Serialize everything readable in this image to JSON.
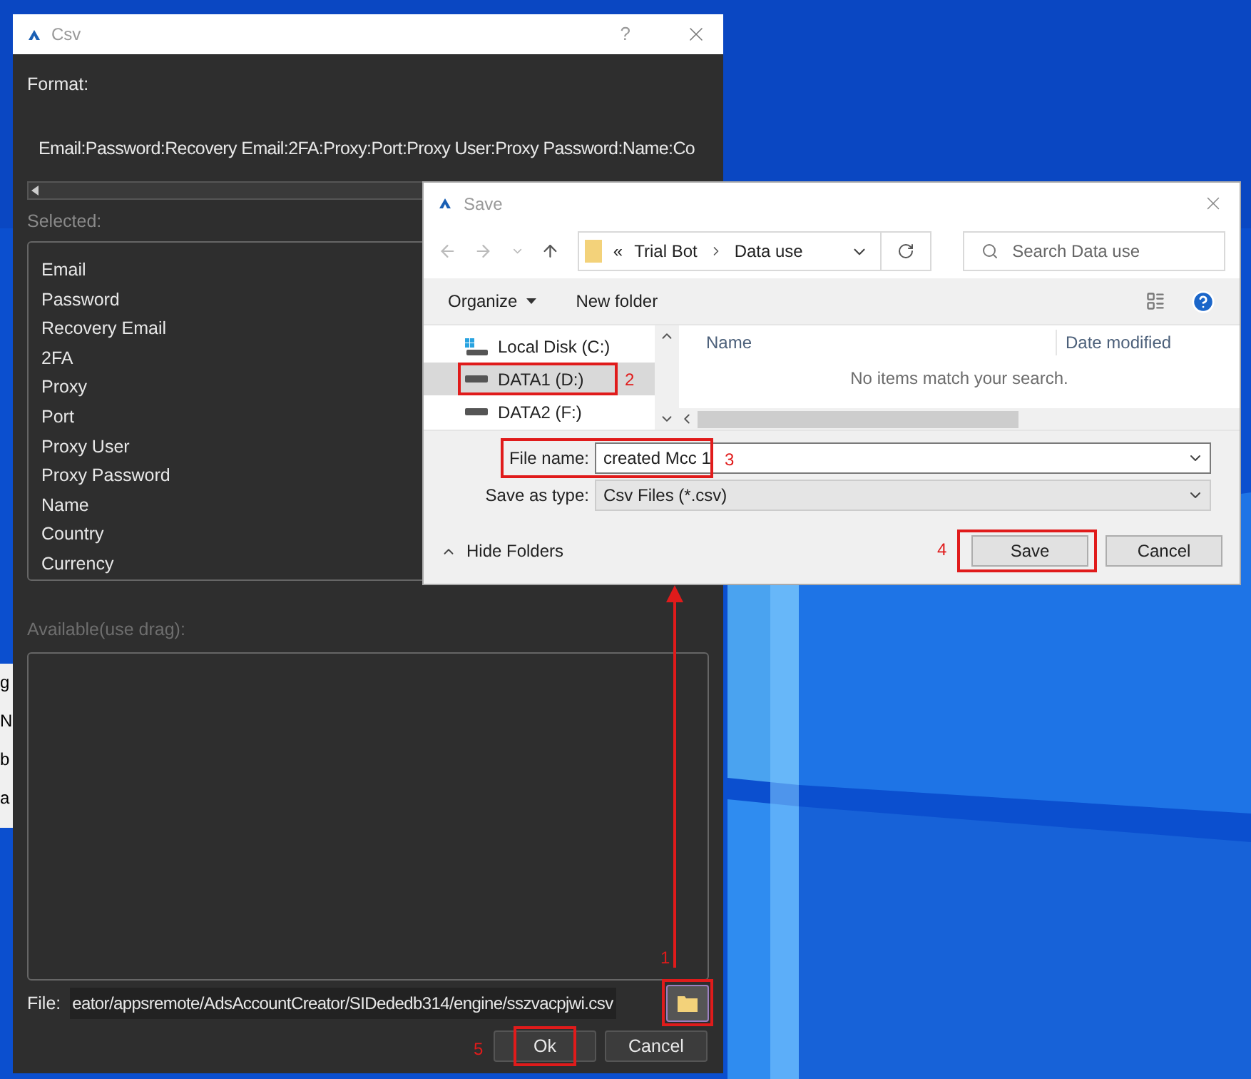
{
  "background_window": {
    "fragments": [
      "g",
      "N",
      "b",
      "a"
    ]
  },
  "csv_window": {
    "title": "Csv",
    "help": "?",
    "format_label": "Format:",
    "format_value": "Email:Password:Recovery Email:2FA:Proxy:Port:Proxy User:Proxy Password:Name:Co",
    "selected_label": "Selected:",
    "selected_fields": [
      "Email",
      "Password",
      "Recovery Email",
      "2FA",
      "Proxy",
      "Port",
      "Proxy User",
      "Proxy Password",
      "Name",
      "Country",
      "Currency"
    ],
    "available_label": "Available(use drag):",
    "file_label": "File:",
    "file_path": "eator/appsremote/AdsAccountCreator/SIDededb314/engine/sszvacpjwi.csv",
    "buttons": [
      "Ok",
      "Cancel"
    ]
  },
  "save_dialog": {
    "title": "Save",
    "breadcrumb_prefix": "«",
    "breadcrumb": [
      "Trial Bot",
      "Data use"
    ],
    "search": {
      "placeholder": "Search Data use"
    },
    "toolbar": [
      "Organize",
      "New folder"
    ],
    "nav_items": [
      {
        "label": "Local Disk (C:)",
        "kind": "system",
        "selected": false
      },
      {
        "label": "DATA1 (D:)",
        "kind": "drive",
        "selected": true
      },
      {
        "label": "DATA2 (F:)",
        "kind": "drive",
        "selected": false
      }
    ],
    "columns": [
      "Name",
      "Date modified"
    ],
    "empty_message": "No items match your search.",
    "file_name_label": "File name:",
    "file_name": "created Mcc 1",
    "type_label": "Save as type:",
    "type_value": "Csv Files (*.csv)",
    "hide_folders": "Hide Folders",
    "buttons": [
      "Save",
      "Cancel"
    ]
  },
  "annotations": [
    "1",
    "2",
    "3",
    "4",
    "5"
  ]
}
